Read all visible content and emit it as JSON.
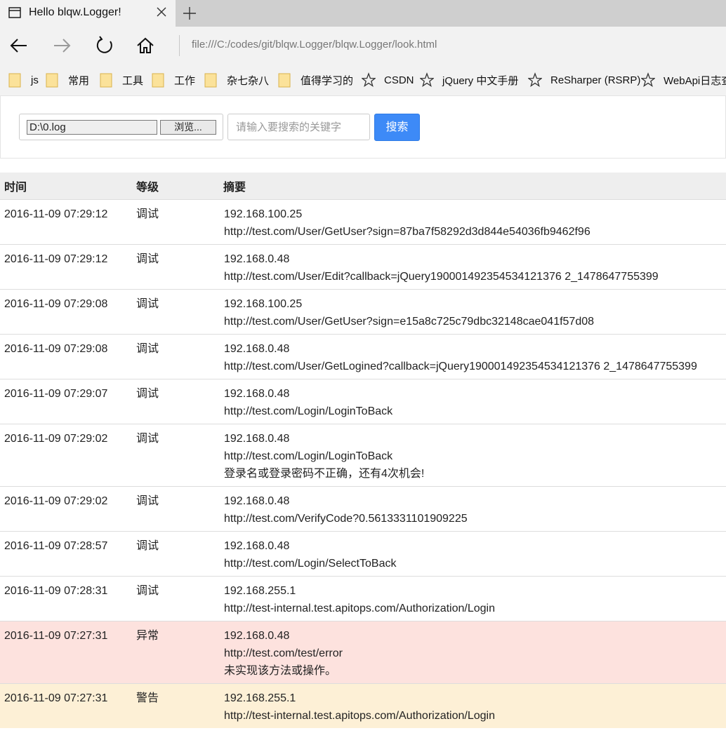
{
  "browser": {
    "tab_title": "Hello blqw.Logger!",
    "address": "file:///C:/codes/git/blqw.Logger/blqw.Logger/look.html",
    "favorites": [
      {
        "label": "js",
        "icon": "folder-icon"
      },
      {
        "label": "常用",
        "icon": "folder-icon"
      },
      {
        "label": "工具",
        "icon": "folder-icon"
      },
      {
        "label": "工作",
        "icon": "folder-icon"
      },
      {
        "label": "杂七杂八",
        "icon": "folder-icon"
      },
      {
        "label": "值得学习的",
        "icon": "folder-icon"
      },
      {
        "label": "CSDN",
        "icon": "star-icon"
      },
      {
        "label": "jQuery 中文手册",
        "icon": "star-icon"
      },
      {
        "label": "ReSharper (RSRP)",
        "icon": "star-icon"
      },
      {
        "label": "WebApi日志查",
        "icon": "star-icon"
      }
    ]
  },
  "search": {
    "file_path": "D:\\0.log",
    "browse_label": "浏览...",
    "keyword_placeholder": "请输入要搜索的关键字",
    "keyword_value": "",
    "search_label": "搜索",
    "accent_color": "#3d8af7"
  },
  "table": {
    "headers": {
      "time": "时间",
      "level": "等级",
      "summary": "摘要"
    },
    "rows": [
      {
        "time": "2016-11-09 07:29:12",
        "level": "调试",
        "lines": [
          "192.168.100.25",
          "http://test.com/User/GetUser?sign=87ba7f58292d3d844e54036fb9462f96"
        ]
      },
      {
        "time": "2016-11-09 07:29:12",
        "level": "调试",
        "lines": [
          "192.168.0.48",
          "http://test.com/User/Edit?callback=jQuery190001492354534121376 2_1478647755399"
        ]
      },
      {
        "time": "2016-11-09 07:29:08",
        "level": "调试",
        "lines": [
          "192.168.100.25",
          "http://test.com/User/GetUser?sign=e15a8c725c79dbc32148cae041f57d08"
        ]
      },
      {
        "time": "2016-11-09 07:29:08",
        "level": "调试",
        "lines": [
          "192.168.0.48",
          "http://test.com/User/GetLogined?callback=jQuery190001492354534121376 2_1478647755399"
        ]
      },
      {
        "time": "2016-11-09 07:29:07",
        "level": "调试",
        "lines": [
          "192.168.0.48",
          "http://test.com/Login/LoginToBack"
        ]
      },
      {
        "time": "2016-11-09 07:29:02",
        "level": "调试",
        "lines": [
          "192.168.0.48",
          "http://test.com/Login/LoginToBack",
          "登录名或登录密码不正确，还有4次机会!"
        ]
      },
      {
        "time": "2016-11-09 07:29:02",
        "level": "调试",
        "lines": [
          "192.168.0.48",
          "http://test.com/VerifyCode?0.5613331101909225"
        ]
      },
      {
        "time": "2016-11-09 07:28:57",
        "level": "调试",
        "lines": [
          "192.168.0.48",
          "http://test.com/Login/SelectToBack"
        ]
      },
      {
        "time": "2016-11-09 07:28:31",
        "level": "调试",
        "lines": [
          "192.168.255.1",
          "http://test-internal.test.apitops.com/Authorization/Login"
        ]
      },
      {
        "time": "2016-11-09 07:27:31",
        "level": "异常",
        "status": "error",
        "lines": [
          "192.168.0.48",
          "http://test.com/test/error",
          "未实现该方法或操作。"
        ]
      },
      {
        "time": "2016-11-09 07:27:31",
        "level": "警告",
        "status": "warn",
        "lines": [
          "192.168.255.1",
          "http://test-internal.test.apitops.com/Authorization/Login"
        ]
      }
    ],
    "status_colors": {
      "error": "#fde2de",
      "warn": "#fdf0d6"
    }
  }
}
